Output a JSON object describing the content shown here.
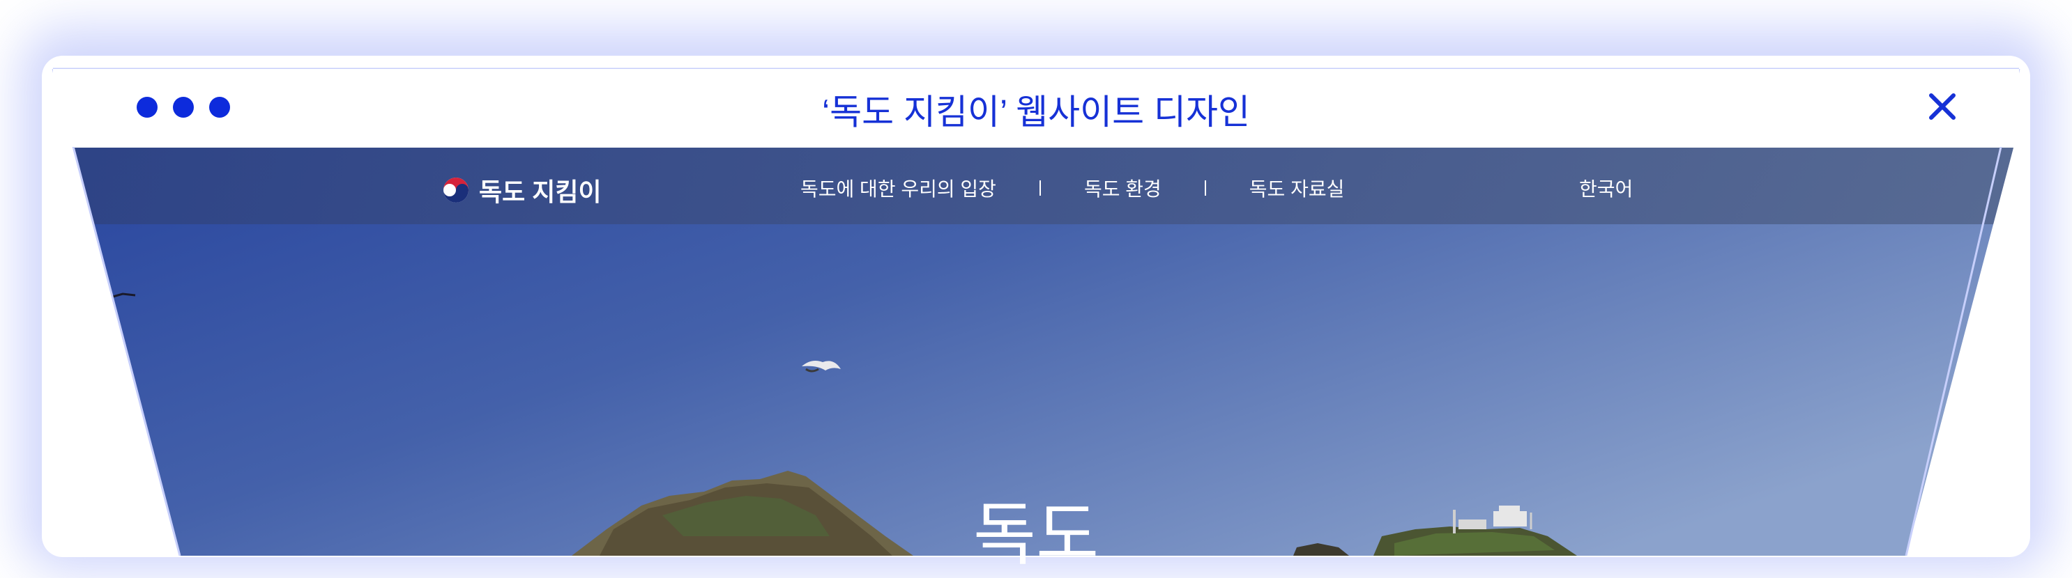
{
  "window": {
    "title": "‘독도 지킴이’ 웹사이트 디자인",
    "close_icon": "close-icon",
    "dot_color": "#0d2bdc",
    "title_color": "#1631d6"
  },
  "site": {
    "logo_text": "독도 지킴이",
    "nav": [
      "독도에 대한 우리의 입장",
      "독도 환경",
      "독도 자료실"
    ],
    "language": "한국어",
    "hero_title": "독도"
  },
  "colors": {
    "sky_top": "#2c4aa0",
    "sky_bottom": "#7b94c8",
    "nav_bar": "#3b4f86"
  }
}
